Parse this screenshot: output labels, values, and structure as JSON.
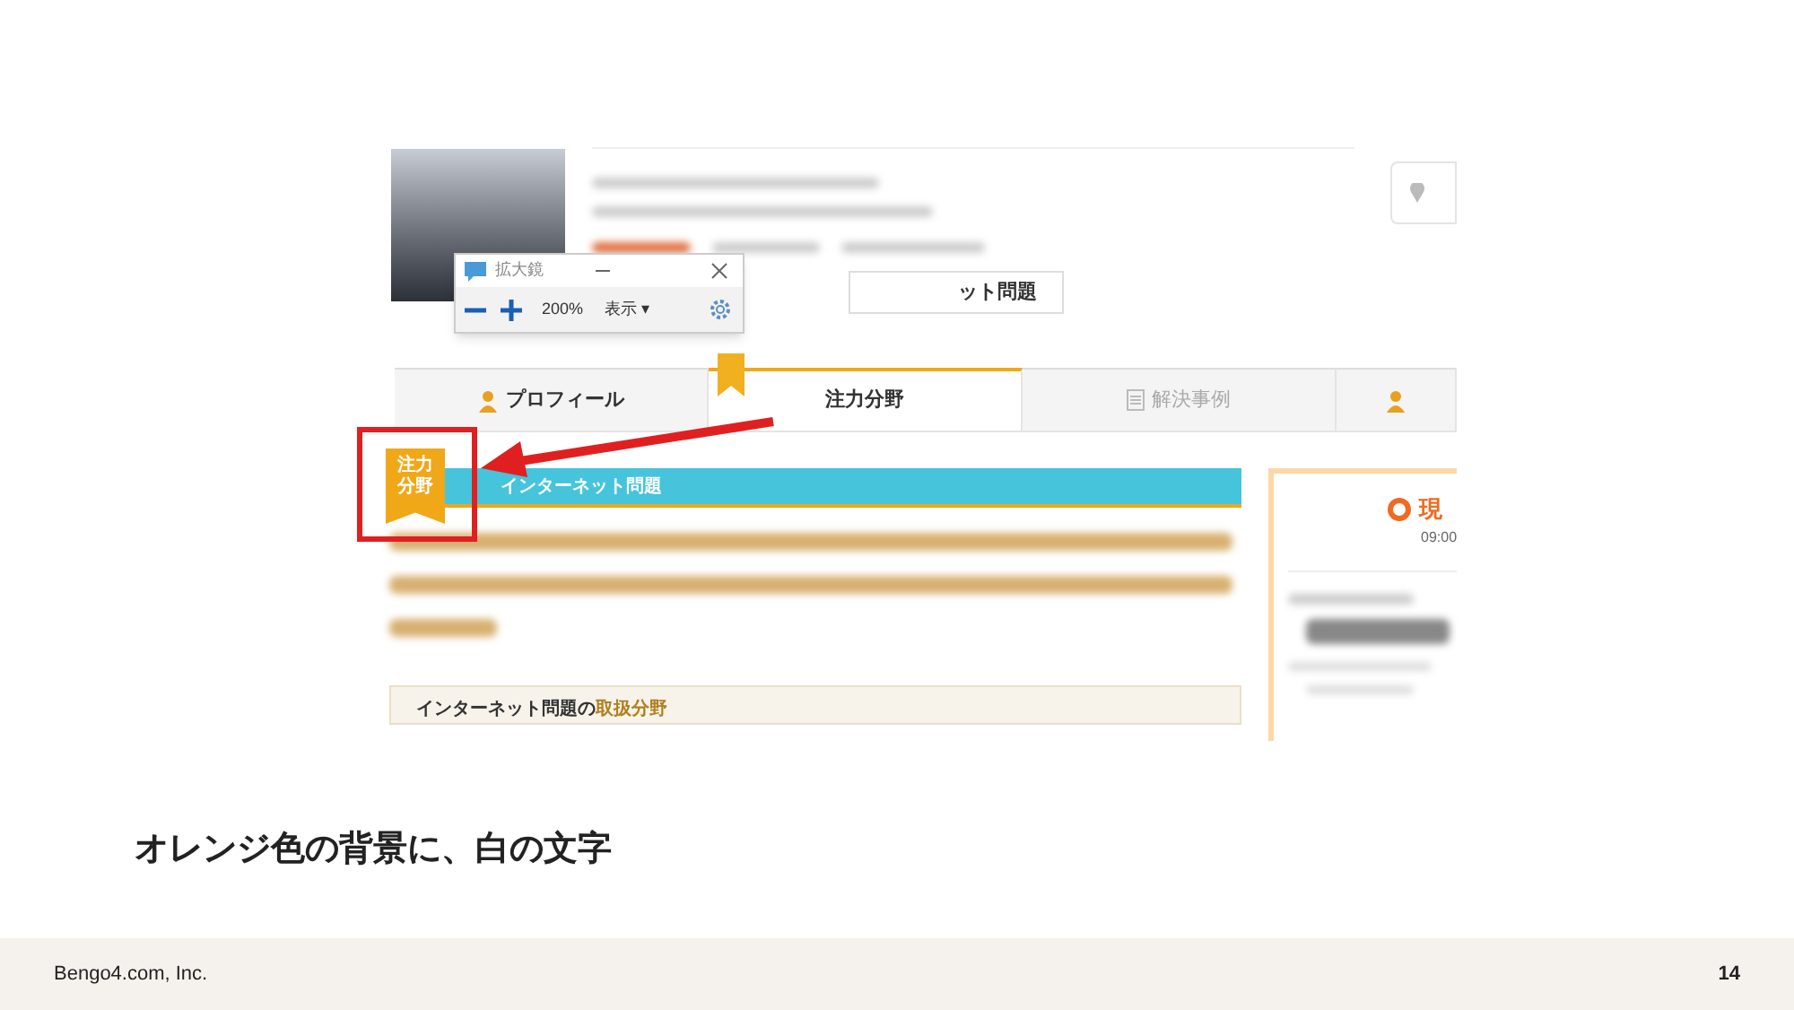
{
  "screenshot": {
    "magnifier": {
      "title": "拡大鏡",
      "zoom": "200%",
      "view_menu": "表示",
      "caret": "▾"
    },
    "profile_button": "ット問題",
    "tabs": [
      {
        "label": "プロフィール",
        "selected": false,
        "kind": "person"
      },
      {
        "label": "注力分野",
        "selected": true,
        "kind": "ribbon"
      },
      {
        "label": "解決事例",
        "selected": false,
        "kind": "doc"
      },
      {
        "selected": false,
        "kind": "person"
      }
    ],
    "badge": {
      "line1": "注力",
      "line2": "分野"
    },
    "banner": "インターネット問題",
    "section": {
      "text": "インターネット問題の",
      "highlight": "取扱分野"
    },
    "side_card": {
      "title": "現",
      "time": "09:00"
    }
  },
  "caption": "オレンジ色の背景に、白の文字",
  "footer": {
    "company": "Bengo4.com, Inc.",
    "page": "14"
  }
}
